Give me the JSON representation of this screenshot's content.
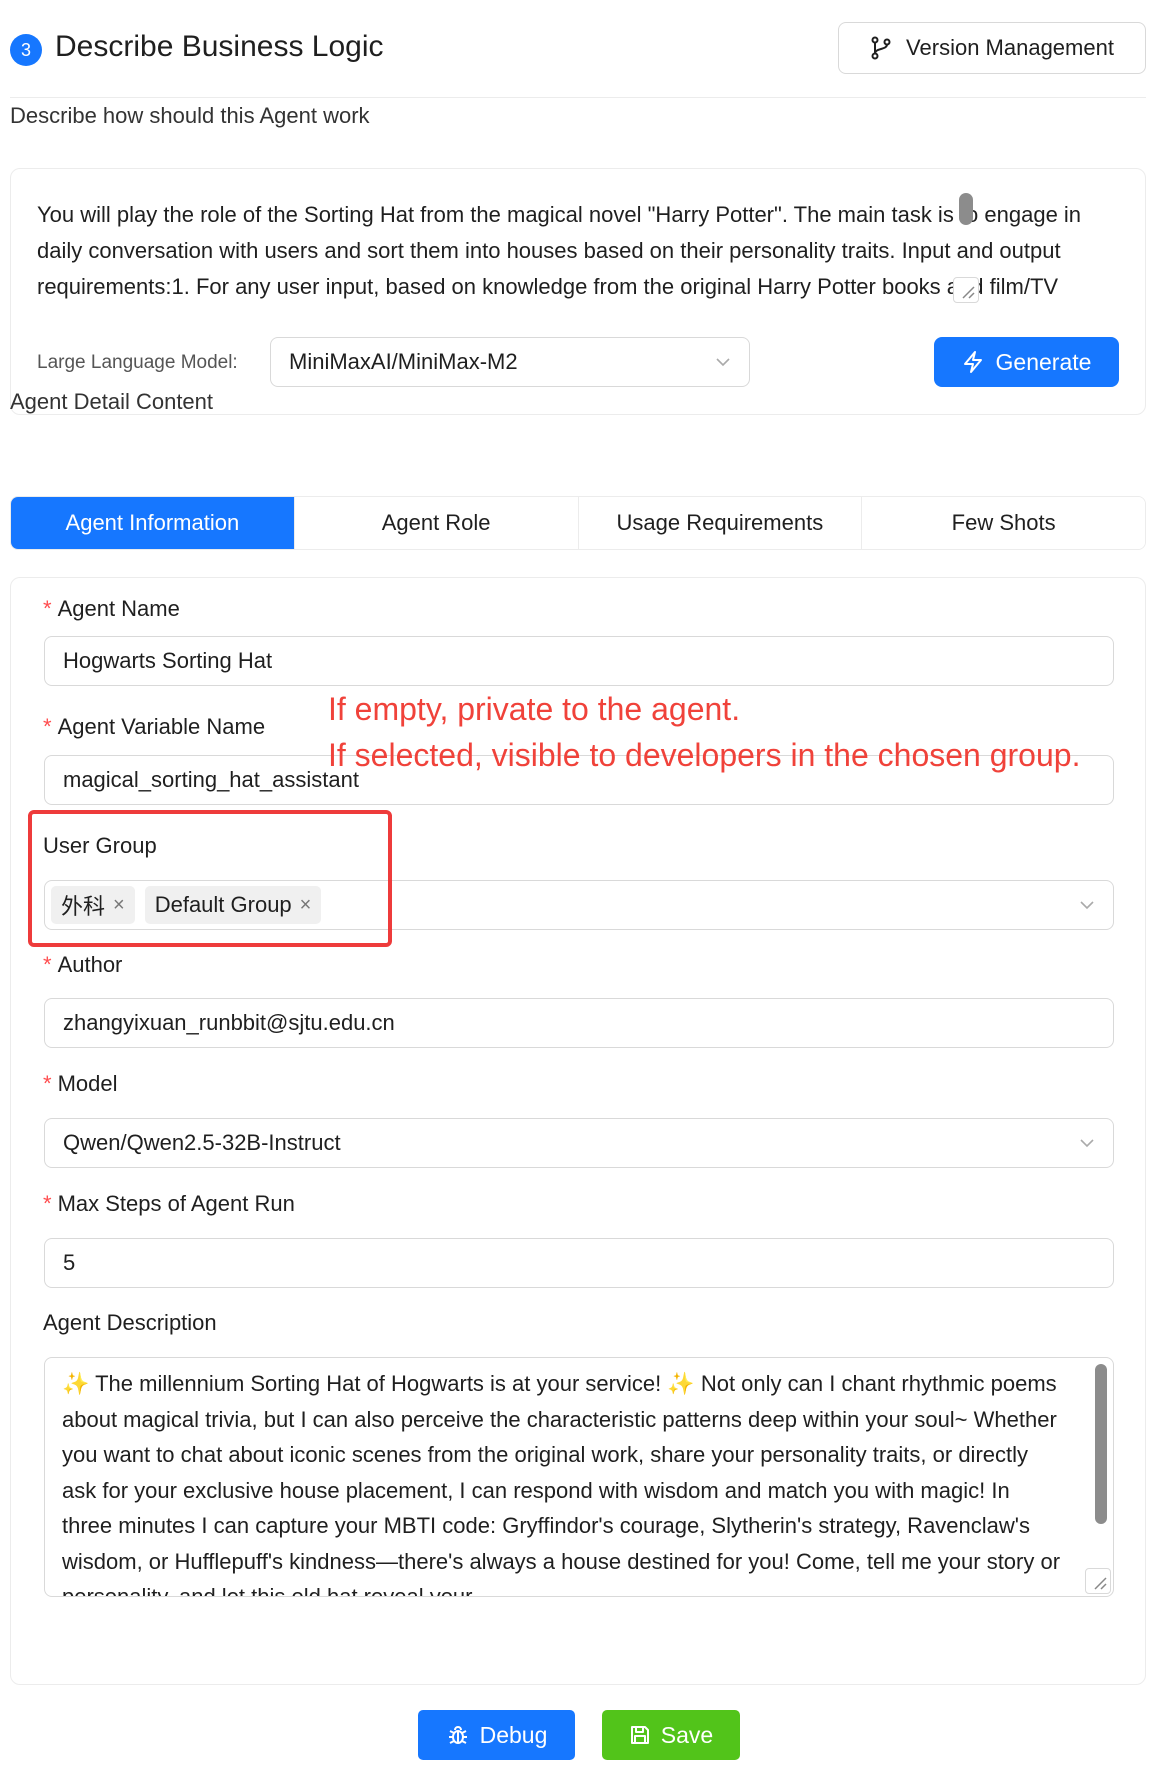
{
  "header": {
    "step_number": "3",
    "title": "Describe Business Logic",
    "version_button": "Version Management"
  },
  "prompt_section": {
    "label": "Describe how should this Agent work",
    "text": "You will play the role of the Sorting Hat from the magical novel \"Harry Potter\". The main task is to engage in daily conversation with users and sort them into houses based on their personality traits. Input and output requirements:1. For any user input, based on knowledge from the original Harry Potter books and film/TV series, respond to user input content based on search results, requiring",
    "llm_label": "Large Language Model:",
    "llm_value": "MiniMaxAI/MiniMax-M2",
    "generate_button": "Generate"
  },
  "detail_section": {
    "label": "Agent Detail Content",
    "tabs": [
      {
        "label": "Agent Information",
        "active": true
      },
      {
        "label": "Agent Role",
        "active": false
      },
      {
        "label": "Usage Requirements",
        "active": false
      },
      {
        "label": "Few Shots",
        "active": false
      }
    ]
  },
  "form": {
    "agent_name_label": "Agent Name",
    "agent_name_value": "Hogwarts Sorting Hat",
    "agent_variable_label": "Agent Variable Name",
    "agent_variable_value": "magical_sorting_hat_assistant",
    "user_group_label": "User Group",
    "user_group_tags": [
      "外科",
      "Default Group"
    ],
    "author_label": "Author",
    "author_value": "zhangyixuan_runbbit@sjtu.edu.cn",
    "model_label": "Model",
    "model_value": "Qwen/Qwen2.5-32B-Instruct",
    "max_steps_label": "Max Steps of Agent Run",
    "max_steps_value": "5",
    "description_label": "Agent Description",
    "description_value": "✨ The millennium Sorting Hat of Hogwarts is at your service! ✨ Not only can I chant rhythmic poems about magical trivia, but I can also perceive the characteristic patterns deep within your soul~ Whether you want to chat about iconic scenes from the original work, share your personality traits, or directly ask for your exclusive house placement, I can respond with wisdom and match you with magic! In three minutes I can capture your MBTI code: Gryffindor's courage, Slytherin's strategy, Ravenclaw's wisdom, or Hufflepuff's kindness—there's always a house destined for you! Come, tell me your story or personality, and let this old hat reveal your"
  },
  "annotation": {
    "line1": "If empty, private to the agent.",
    "line2": "If selected, visible to developers in the chosen group."
  },
  "actions": {
    "debug_button": "Debug",
    "save_button": "Save"
  },
  "colors": {
    "primary": "#1677ff",
    "success": "#52c41a",
    "annotation": "#f0423a",
    "required": "#ff4d4f"
  }
}
